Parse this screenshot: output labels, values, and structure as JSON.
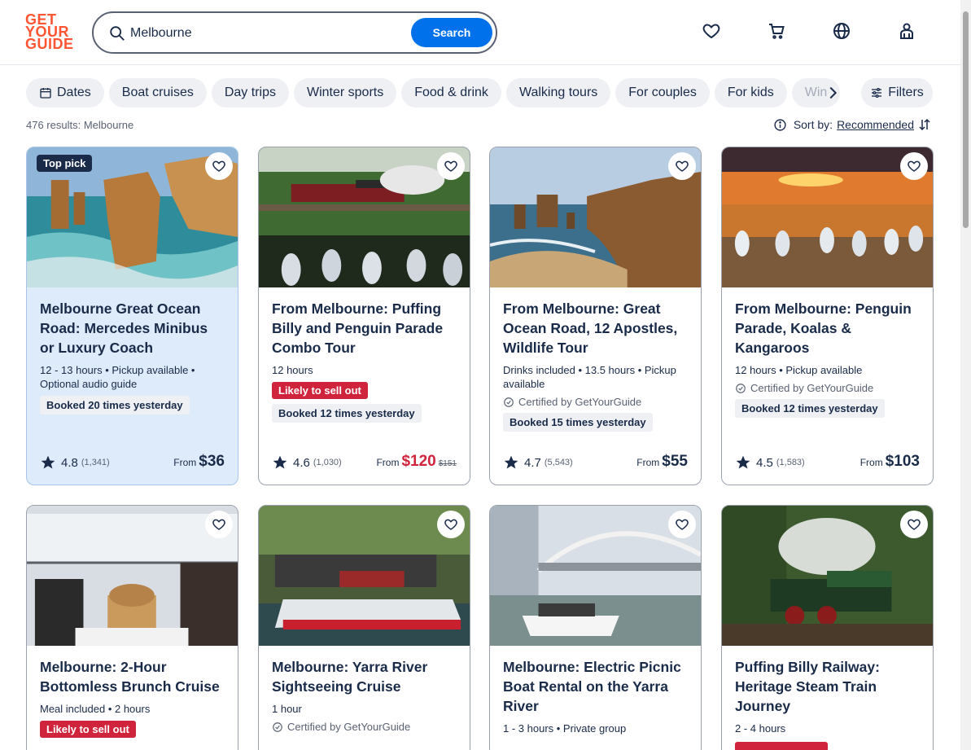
{
  "header": {
    "logo": [
      "GET",
      "YOUR",
      "GUIDE"
    ],
    "search_value": "Melbourne",
    "search_button": "Search",
    "icons": [
      "heart-icon",
      "cart-icon",
      "globe-icon",
      "profile-icon"
    ]
  },
  "chips": [
    {
      "label": "Dates",
      "icon": "calendar-icon"
    },
    {
      "label": "Boat cruises"
    },
    {
      "label": "Day trips"
    },
    {
      "label": "Winter sports"
    },
    {
      "label": "Food & drink"
    },
    {
      "label": "Walking tours"
    },
    {
      "label": "For couples"
    },
    {
      "label": "For kids"
    },
    {
      "label": "Win"
    }
  ],
  "filters_label": "Filters",
  "results": {
    "count_text": "476 results: Melbourne",
    "sort_label": "Sort by:",
    "sort_value": "Recommended"
  },
  "cards": [
    {
      "title": "Melbourne Great Ocean Road: Mercedes Minibus or Luxury Coach",
      "meta": "12 - 13 hours • Pickup available • Optional audio guide",
      "top_pick": "Top pick",
      "booked": "Booked 20 times yesterday",
      "rating": "4.8",
      "reviews": "(1,341)",
      "from": "From",
      "price": "$36"
    },
    {
      "title": "From Melbourne: Puffing Billy and Penguin Parade Combo Tour",
      "meta": "12 hours",
      "sell_out": "Likely to sell out",
      "booked": "Booked 12 times yesterday",
      "rating": "4.6",
      "reviews": "(1,030)",
      "from": "From",
      "price": "$120",
      "old_price": "$151"
    },
    {
      "title": "From Melbourne: Great Ocean Road, 12 Apostles, Wildlife Tour",
      "meta": "Drinks included • 13.5 hours • Pickup available",
      "certified": "Certified by GetYourGuide",
      "booked": "Booked 15 times yesterday",
      "rating": "4.7",
      "reviews": "(5,543)",
      "from": "From",
      "price": "$55"
    },
    {
      "title": "From Melbourne: Penguin Parade, Koalas & Kangaroos",
      "meta": "12 hours • Pickup available",
      "certified": "Certified by GetYourGuide",
      "booked": "Booked 12 times yesterday",
      "rating": "4.5",
      "reviews": "(1,583)",
      "from": "From",
      "price": "$103"
    },
    {
      "title": "Melbourne: 2-Hour Bottomless Brunch Cruise",
      "meta": "Meal included • 2 hours",
      "sell_out": "Likely to sell out"
    },
    {
      "title": "Melbourne: Yarra River Sightseeing Cruise",
      "meta": "1 hour",
      "certified": "Certified by GetYourGuide"
    },
    {
      "title": "Melbourne: Electric Picnic Boat Rental on the Yarra River",
      "meta": "1 - 3 hours • Private group"
    },
    {
      "title": "Puffing Billy Railway: Heritage Steam Train Journey",
      "meta": "2 - 4 hours"
    }
  ],
  "colors": {
    "brand": "#ff5533",
    "primary": "#0071eb",
    "text": "#1a2b49",
    "sale": "#d0233c",
    "highlight": "#deebfb"
  }
}
